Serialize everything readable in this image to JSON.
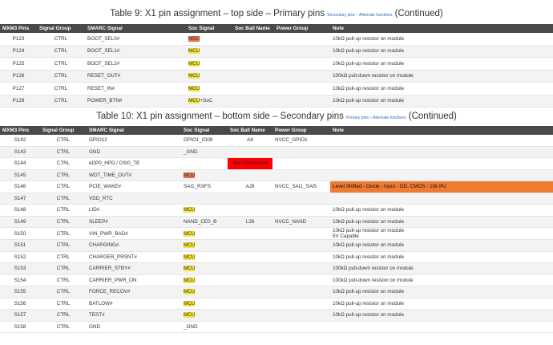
{
  "table1": {
    "caption_main": "Table 9:  X1 pin assignment – top side – Primary pins",
    "caption_small": "Secondary pins – Alternate functions",
    "caption_end": "(Continued)",
    "headers": [
      "MXM3 Pins",
      "Signal Group",
      "SMARC Signal",
      "Soc Signal",
      "Soc Ball Name",
      "Power Group",
      "Note"
    ],
    "rows": [
      {
        "pin": "P123",
        "group": "CTRL",
        "smarc": "BOOT_SEL0#",
        "soc": "MCU",
        "soc_style": "red",
        "soc_suffix": "",
        "ball": "",
        "power": "",
        "note": "10kΩ pull-up resistor on module"
      },
      {
        "pin": "P124",
        "group": "CTRL",
        "smarc": "BOOT_SEL1#",
        "soc": "MCU",
        "soc_style": "yellow",
        "soc_suffix": "",
        "ball": "",
        "power": "",
        "note": "10kΩ pull-up resistor on module"
      },
      {
        "pin": "P125",
        "group": "CTRL",
        "smarc": "BOOT_SEL2#",
        "soc": "MCU",
        "soc_style": "yellow",
        "soc_suffix": "",
        "ball": "",
        "power": "",
        "note": "10kΩ pull-up resistor on module"
      },
      {
        "pin": "P126",
        "group": "CTRL",
        "smarc": "RESET_OUT#",
        "soc": "MCU",
        "soc_style": "yellow",
        "soc_suffix": "",
        "ball": "",
        "power": "",
        "note": "100kΩ pull-down resistor on module"
      },
      {
        "pin": "P127",
        "group": "CTRL",
        "smarc": "RESET_IN#",
        "soc": "MCU",
        "soc_style": "yellow",
        "soc_suffix": "",
        "ball": "",
        "power": "",
        "note": "10kΩ pull-up resistor on module"
      },
      {
        "pin": "P128",
        "group": "CTRL",
        "smarc": "POWER_BTN#",
        "soc": "MCU",
        "soc_style": "yellow",
        "soc_suffix": "+SoC",
        "ball": "",
        "power": "",
        "note": "10kΩ pull-up resistor on module"
      }
    ]
  },
  "table2": {
    "caption_main": "Table 10:  X1 pin assignment – bottom side – Secondary pins",
    "caption_small": "Primary pins – Alternate functions",
    "caption_end": "(Continued)",
    "headers": [
      "MXM3 Pins",
      "Signal Group",
      "SMARC Signal",
      "Soc Signal",
      "Soc Ball Name",
      "Power Group",
      "Note"
    ],
    "rows": [
      {
        "pin": "S142",
        "group": "CTRL",
        "smarc": "GPIO12",
        "soc": "GPIO1_IO08",
        "soc_style": "",
        "ball": "A8",
        "ball_style": "",
        "power": "NVCC_GPIO1",
        "note": "",
        "note_style": ""
      },
      {
        "pin": "S143",
        "group": "CTRL",
        "smarc": "GND",
        "soc": "_GND",
        "soc_style": "",
        "ball": "",
        "ball_style": "",
        "power": "",
        "note": "",
        "note_style": ""
      },
      {
        "pin": "S144",
        "group": "CTRL",
        "smarc": "eDP0_HPD / DSI0_TE",
        "soc": "",
        "soc_style": "",
        "ball": "Not Connected",
        "ball_style": "nc",
        "power": "",
        "note": "",
        "note_style": ""
      },
      {
        "pin": "S145",
        "group": "CTRL",
        "smarc": "WDT_TIME_OUT#",
        "soc": "MCU",
        "soc_style": "red",
        "ball": "",
        "ball_style": "",
        "power": "",
        "note": "",
        "note_style": ""
      },
      {
        "pin": "S146",
        "group": "CTRL",
        "smarc": "PCIE_WAKE#",
        "soc": "SAI1_RXFS",
        "soc_style": "",
        "ball": "AJ9",
        "ball_style": "",
        "power": "NVCC_SAI1_SAI5",
        "note": "Level Shifted - Diode - Input - OD, CMOS - 10k PU",
        "note_style": "warn"
      },
      {
        "pin": "S147",
        "group": "CTRL",
        "smarc": "VDD_RTC",
        "soc": "",
        "soc_style": "",
        "ball": "",
        "ball_style": "",
        "power": "",
        "note": "",
        "note_style": ""
      },
      {
        "pin": "S148",
        "group": "CTRL",
        "smarc": "LID#",
        "soc": "MCU",
        "soc_style": "yellow",
        "ball": "",
        "ball_style": "",
        "power": "",
        "note": "10kΩ pull-up resistor on module",
        "note_style": ""
      },
      {
        "pin": "S149",
        "group": "CTRL",
        "smarc": "SLEEP#",
        "soc": "NAND_CE0_B",
        "soc_style": "",
        "ball": "L26",
        "ball_style": "",
        "power": "NVCC_NAND",
        "note": "10kΩ pull-up resistor on module",
        "note_style": ""
      },
      {
        "pin": "S150",
        "group": "CTRL",
        "smarc": "VIN_PWR_BAD#",
        "soc": "MCU",
        "soc_style": "yellow",
        "ball": "",
        "ball_style": "",
        "power": "",
        "note": "10kΩ pull-up resistor on module",
        "note2": "5V Capable",
        "note_style": ""
      },
      {
        "pin": "S151",
        "group": "CTRL",
        "smarc": "CHARGING#",
        "soc": "MCU",
        "soc_style": "yellow",
        "ball": "",
        "ball_style": "",
        "power": "",
        "note": "10kΩ pull-up resistor on module",
        "note_style": ""
      },
      {
        "pin": "S152",
        "group": "CTRL",
        "smarc": "CHARGER_PRSNT#",
        "soc": "MCU",
        "soc_style": "yellow",
        "ball": "",
        "ball_style": "",
        "power": "",
        "note": "10kΩ pull-up resistor on module",
        "note_style": ""
      },
      {
        "pin": "S153",
        "group": "CTRL",
        "smarc": "CARRIER_STBY#",
        "soc": "MCU",
        "soc_style": "yellow",
        "ball": "",
        "ball_style": "",
        "power": "",
        "note": "100kΩ pull-down resistor on module",
        "note_style": ""
      },
      {
        "pin": "S154",
        "group": "CTRL",
        "smarc": "CARRIER_PWR_ON",
        "soc": "MCU",
        "soc_style": "yellow",
        "ball": "",
        "ball_style": "",
        "power": "",
        "note": "100kΩ pull-down resistor on module",
        "note_style": ""
      },
      {
        "pin": "S155",
        "group": "CTRL",
        "smarc": "FORCE_RECOV#",
        "soc": "MCU",
        "soc_style": "yellow",
        "ball": "",
        "ball_style": "",
        "power": "",
        "note": "10kΩ pull-up resistor on module",
        "note_style": ""
      },
      {
        "pin": "S156",
        "group": "CTRL",
        "smarc": "BATLOW#",
        "soc": "MCU",
        "soc_style": "yellow",
        "ball": "",
        "ball_style": "",
        "power": "",
        "note": "10kΩ pull-up resistor on module",
        "note_style": ""
      },
      {
        "pin": "S157",
        "group": "CTRL",
        "smarc": "TEST#",
        "soc": "MCU",
        "soc_style": "yellow",
        "ball": "",
        "ball_style": "",
        "power": "",
        "note": "10kΩ pull-up resistor on module",
        "note_style": ""
      },
      {
        "pin": "S158",
        "group": "CTRL",
        "smarc": "GND",
        "soc": "_GND",
        "soc_style": "",
        "ball": "",
        "ball_style": "",
        "power": "",
        "note": "",
        "note_style": ""
      }
    ]
  },
  "colors": {
    "header_bg": "#4a4a4a",
    "mcu_yellow": "#f5e23a",
    "mcu_red": "#e8734a",
    "not_connected": "#ff0000",
    "warning_note": "#f07a32"
  }
}
